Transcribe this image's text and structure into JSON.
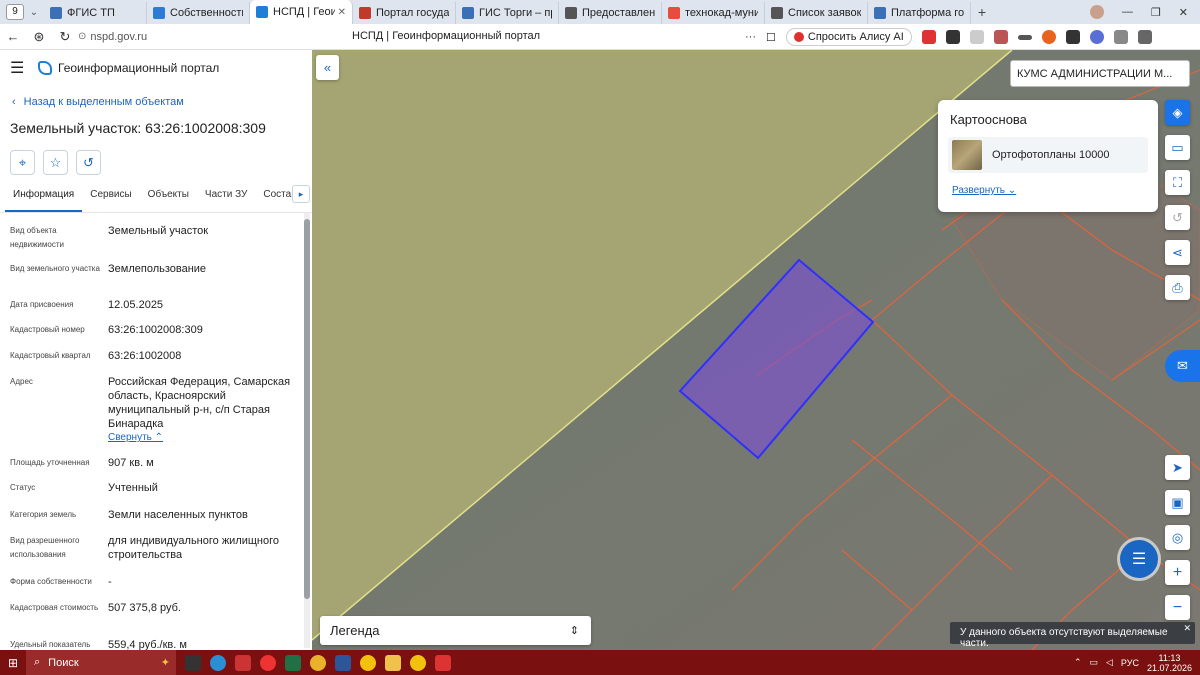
{
  "browser": {
    "tab_count": "9",
    "tabs": [
      {
        "label": "ФГИС ТП",
        "color": "#3b6fb6"
      },
      {
        "label": "Собственность-WEB",
        "color": "#2e7bd6"
      },
      {
        "label": "НСПД | Геоинфор",
        "color": "#1f7fd6",
        "active": true
      },
      {
        "label": "Портал государстве",
        "color": "#c0392b"
      },
      {
        "label": "ГИС Торги – продаж",
        "color": "#3b6fb6"
      },
      {
        "label": "Предоставление све",
        "color": "#555555"
      },
      {
        "label": "технокад-муниципа",
        "color": "#e74c3c"
      },
      {
        "label": "Список заявок — Те",
        "color": "#555555"
      },
      {
        "label": "Платформа государс",
        "color": "#3b6fb6"
      }
    ],
    "url": "nspd.gov.ru",
    "page_title": "НСПД | Геоинформационный портал",
    "alice_button": "Спросить Алису AI"
  },
  "app": {
    "name": "Геоинформационный портал",
    "back_link": "Назад к выделенным объектам",
    "object_title": "Земельный участок: 63:26:1002008:309",
    "tabs": [
      "Информация",
      "Сервисы",
      "Объекты",
      "Части ЗУ",
      "Состав"
    ],
    "active_tab": 0,
    "properties": [
      {
        "key": "Вид объекта недвижимости",
        "value": "Земельный участок"
      },
      {
        "key": "Вид земельного участка",
        "value": "Землепользование"
      },
      {
        "key": "Дата присвоения",
        "value": "12.05.2025"
      },
      {
        "key": "Кадастровый номер",
        "value": "63:26:1002008:309"
      },
      {
        "key": "Кадастровый квартал",
        "value": "63:26:1002008"
      },
      {
        "key": "Адрес",
        "value": "Российская Федерация, Самарская область, Красноярский муниципальный р-н, с/п Старая Бинарадка",
        "link": "Свернуть"
      },
      {
        "key": "Площадь уточненная",
        "value": "907 кв. м"
      },
      {
        "key": "Статус",
        "value": "Учтенный"
      },
      {
        "key": "Категория земель",
        "value": "Земли населенных пунктов"
      },
      {
        "key": "Вид разрешенного использования",
        "value": "для индивидуального жилищного строительства"
      },
      {
        "key": "Форма собственности",
        "value": "-"
      },
      {
        "key": "Кадастровая стоимость",
        "value": "507 375,8 руб."
      },
      {
        "key": "Удельный показатель",
        "value": "559,4 руб./кв. м"
      }
    ]
  },
  "map": {
    "org_select": "КУМС АДМИНИСТРАЦИИ М...",
    "basemap_title": "Картооснова",
    "basemap_item": "Ортофотопланы 10000",
    "expand_link": "Развернуть",
    "legend": "Легенда",
    "toast": "У данного объекта отсутствуют выделяемые части."
  },
  "taskbar": {
    "search": "Поиск",
    "lang": "РУС",
    "time": "11:13",
    "date": "21.07.2026"
  },
  "colors": {
    "accent": "#1a66c2",
    "selected_parcel_fill": "#7b4fd6",
    "parcel_border": "#e0643c",
    "taskbar": "#7a1010"
  }
}
